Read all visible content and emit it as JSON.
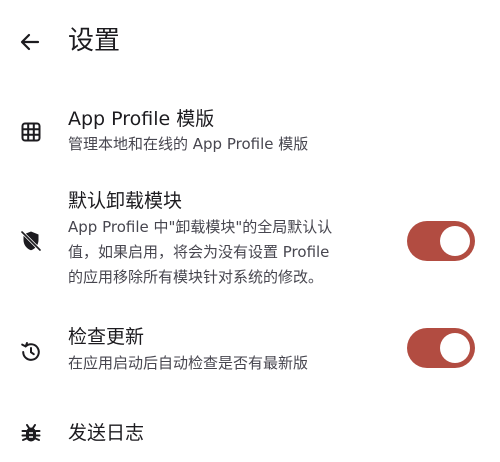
{
  "header": {
    "title": "设置",
    "back_icon": "arrow-back-icon"
  },
  "settings": [
    {
      "icon": "grid-icon",
      "title": "App Profile 模版",
      "subtitle": [
        "管理本地和在线的 App Profile 模版"
      ]
    },
    {
      "icon": "shield-off-icon",
      "title": "默认卸载模块",
      "subtitle": [
        "App Profile 中\"卸载模块\"的全局默认认",
        "值，如果启用，将会为没有设置 Profile",
        "的应用移除所有模块针对系统的修改。"
      ],
      "toggle": true
    },
    {
      "icon": "update-icon",
      "title": "检查更新",
      "subtitle": [
        "在应用启动后自动检查是否有最新版"
      ],
      "toggle": true
    },
    {
      "icon": "bug-icon",
      "title": "发送日志"
    }
  ],
  "colors": {
    "switch_on": "#b24c41",
    "text_primary": "#1c1b1f",
    "text_secondary": "#47464f"
  }
}
